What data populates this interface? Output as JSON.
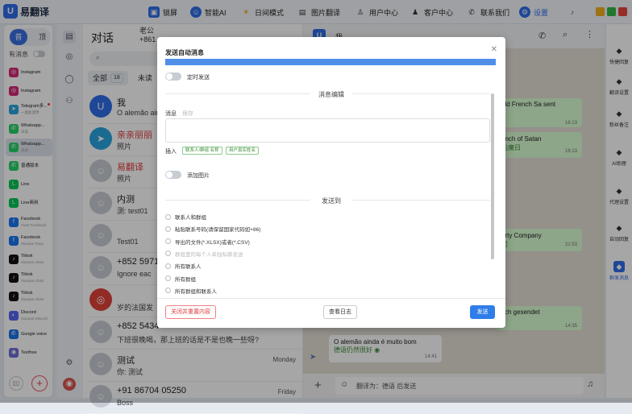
{
  "app": {
    "logo_mark": "U",
    "name": "易翻译"
  },
  "topnav": [
    {
      "label": "锁屏",
      "icon": "lock-icon"
    },
    {
      "label": "智能AI",
      "icon": "robot-icon"
    },
    {
      "label": "日间模式",
      "icon": "sun-icon"
    },
    {
      "label": "图片翻译",
      "icon": "image-translate-icon"
    },
    {
      "label": "用户中心",
      "icon": "user-icon"
    },
    {
      "label": "客户中心",
      "icon": "customer-icon"
    },
    {
      "label": "联系我们",
      "icon": "phone-icon"
    },
    {
      "label": "设置",
      "icon": "settings-icon"
    }
  ],
  "leftcol": {
    "mode_a": "普",
    "mode_b": "顶",
    "has_msg_label": "有消息",
    "accounts": [
      {
        "name": "Instagram",
        "sub": "",
        "color": "#d62976",
        "glyph": "◎"
      },
      {
        "name": "Instagram",
        "sub": "",
        "color": "#d62976",
        "glyph": "◎"
      },
      {
        "name": "Telegram多...",
        "sub": "一直能混用",
        "color": "#2aa3df",
        "glyph": "➤",
        "dot": true
      },
      {
        "name": "Whatsapp...",
        "sub": "未读",
        "color": "#25d366",
        "glyph": "✆"
      },
      {
        "name": "Whatsapp...",
        "sub": "未读",
        "color": "#25d366",
        "glyph": "✆",
        "sel": true
      },
      {
        "name": "普通版本",
        "sub": "",
        "color": "#25d366",
        "glyph": "✆"
      },
      {
        "name": "Line",
        "sub": "",
        "color": "#06c755",
        "glyph": "L"
      },
      {
        "name": "Line商用",
        "sub": "",
        "color": "#06c755",
        "glyph": "L"
      },
      {
        "name": "Facebook",
        "sub": "Yuan Facebook",
        "color": "#1877f2",
        "glyph": "f"
      },
      {
        "name": "Facebook",
        "sub": "Xiaoyan Fang",
        "color": "#1877f2",
        "glyph": "f"
      },
      {
        "name": "Tiktok",
        "sub": "Xiaoyan chat1",
        "color": "#111",
        "glyph": "♪"
      },
      {
        "name": "Tiktok",
        "sub": "Xiaoyan chat1",
        "color": "#111",
        "glyph": "♪"
      },
      {
        "name": "Tiktok",
        "sub": "Xiaoyan chat1",
        "color": "#111",
        "glyph": "♪"
      },
      {
        "name": "Discord",
        "sub": "Xiaoyan Discord",
        "color": "#5865f2",
        "glyph": "◐"
      },
      {
        "name": "Google voice",
        "sub": "",
        "color": "#1a73e8",
        "glyph": "✆"
      },
      {
        "name": "Textfree",
        "sub": "",
        "color": "#6c6cd6",
        "glyph": "◉"
      }
    ],
    "add_label": "+"
  },
  "conv": {
    "title": "对话",
    "sub1": "老公",
    "sub2": "+861",
    "search_placeholder": "",
    "tab_all": "全部",
    "tab_all_count": "18",
    "tab_unread": "未读",
    "items": [
      {
        "name": "我",
        "preview": "O alemão ain",
        "time": "",
        "avatar": "U",
        "color": "#2f6ee8"
      },
      {
        "name": "亲亲丽丽",
        "preview": "照片",
        "time": "",
        "avatar": "➤",
        "color": "#2aa3df",
        "red": true
      },
      {
        "name": "易翻译",
        "preview": "照片",
        "time": "",
        "avatar": "",
        "color": "#c7cbd3",
        "red": true
      },
      {
        "name": "内测",
        "preview": "测: test01",
        "time": "",
        "avatar": "",
        "color": "#c7cbd3"
      },
      {
        "name": "",
        "preview": "Test01",
        "time": "",
        "avatar": "",
        "color": "#c7cbd3"
      },
      {
        "name": "+852 5971",
        "preview": "Ignore eac",
        "time": "",
        "avatar": "",
        "color": "#c7cbd3"
      },
      {
        "name": "",
        "preview": "岁的法国发",
        "time": "",
        "avatar": "◎",
        "color": "#e0433a"
      },
      {
        "name": "+852 5434",
        "preview": "下班很晚喝，那上班的话是不是也晚一些呀?",
        "time": "",
        "avatar": "",
        "color": "#c7cbd3"
      },
      {
        "name": "测试",
        "preview": "你: 测试",
        "time": "Monday",
        "avatar": "",
        "color": "#c7cbd3"
      },
      {
        "name": "+91 86704 05250",
        "preview": "Boss",
        "time": "Friday",
        "avatar": "",
        "color": "#c7cbd3"
      }
    ]
  },
  "chat": {
    "avatar": "U",
    "name": "我",
    "bubbles": [
      {
        "text": "old French Sa sent",
        "time": "16:13"
      },
      {
        "text": "anch of Satan",
        "text2": "的魔日",
        "time": "16:13"
      },
      {
        "text": "erty Company",
        "text2": "司",
        "time": "21:53"
      },
      {
        "text": "sch gesendet",
        "time": "14:35"
      }
    ],
    "last_text": "O alemão ainda é muito bom",
    "last_trans": "德语仍然很好",
    "last_time": "14:41",
    "input_placeholder": "翻译为：德语 后发送"
  },
  "rightbar": [
    {
      "label": "快捷回复",
      "icon": "quick-reply-icon"
    },
    {
      "label": "翻译设置",
      "icon": "translate-settings-icon"
    },
    {
      "label": "粉丝备注",
      "icon": "fans-notes-icon"
    },
    {
      "label": "AI助理",
      "icon": "ai-assistant-icon"
    },
    {
      "label": "代理设置",
      "icon": "proxy-settings-icon"
    },
    {
      "label": "自动回复",
      "icon": "auto-reply-icon"
    },
    {
      "label": "群发消息",
      "icon": "broadcast-icon",
      "active": true
    }
  ],
  "modal": {
    "title": "发送自动消息",
    "scheduled_label": "定时发送",
    "msg_edit_label": "消息编辑",
    "msg_label": "消息",
    "save_label": "保存",
    "insert_label": "插入",
    "chip1": "联系人/群组 名称",
    "chip2": "用户真实姓名",
    "add_image_label": "添加图片",
    "send_to_label": "发送到",
    "options": [
      "联系人和群组",
      "粘贴联系号码(请保留国家代码如+86)",
      "导出的文件(*.XLSX)或者(*.CSV)",
      "群组里的每个人单独私聊发送",
      "所有联系人",
      "所有群组",
      "所有群组和联系人"
    ],
    "close_label": "关闭并重置内容",
    "log_label": "查看日志",
    "send_label": "发送"
  },
  "colors": {
    "accent": "#2f7de8",
    "danger": "#e03a3a",
    "bubble": "#d9fdd3",
    "chip": "#3d8b3d"
  }
}
